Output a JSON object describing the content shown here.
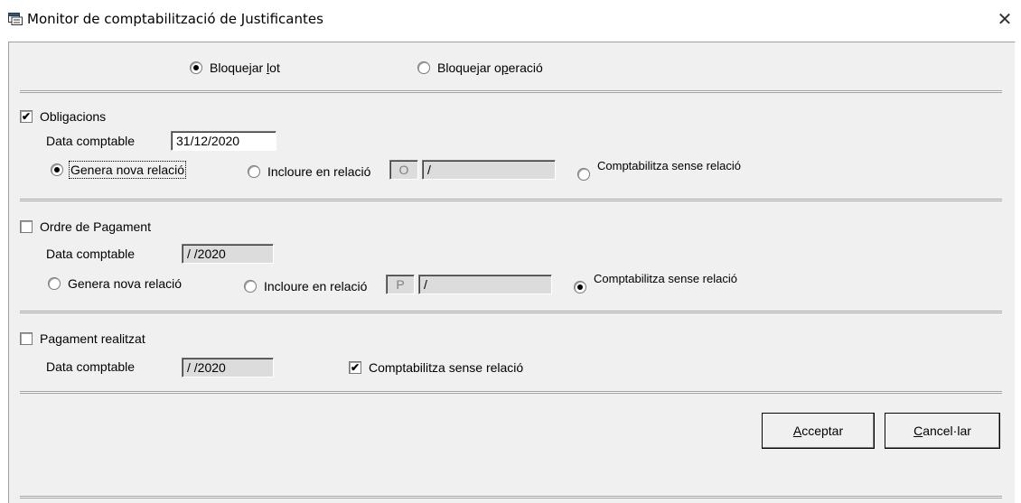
{
  "window": {
    "title": "Monitor de comptabilització de Justificantes",
    "close_glyph": "✕",
    "icon": "window-app-icon"
  },
  "lock_mode": {
    "options": [
      {
        "label_pre": "Bloquejar ",
        "label_u": "l",
        "label_post": "ot",
        "selected": true
      },
      {
        "label_pre": "Bloquejar o",
        "label_u": "p",
        "label_post": "eració",
        "selected": false
      }
    ]
  },
  "obligacions": {
    "checkbox_label": "Obligacions",
    "checked": "✔",
    "date_label": "Data comptable",
    "date_value": "31/12/2020",
    "radio_new": "Genera nova relació",
    "radio_include": "Incloure en relació",
    "include_code": "O",
    "include_value": "/",
    "radio_without": "Comptabilitza sense relació"
  },
  "ordre_pagament": {
    "checkbox_label": "Ordre de Pagament",
    "date_label": "Data comptable",
    "date_value": "/ /2020",
    "radio_new": "Genera nova relació",
    "radio_include": "Incloure en relació",
    "include_code": "P",
    "include_value": "/",
    "radio_without": "Comptabilitza sense relació"
  },
  "pagament_realitzat": {
    "checkbox_label": "Pagament realitzat",
    "date_label": "Data comptable",
    "date_value": "/ /2020",
    "check_without_label": "Comptabilitza sense relació",
    "check_without_mark": "✔"
  },
  "buttons": {
    "accept_u": "A",
    "accept_rest": "cceptar",
    "cancel_u": "C",
    "cancel_rest": "ancel·lar"
  }
}
